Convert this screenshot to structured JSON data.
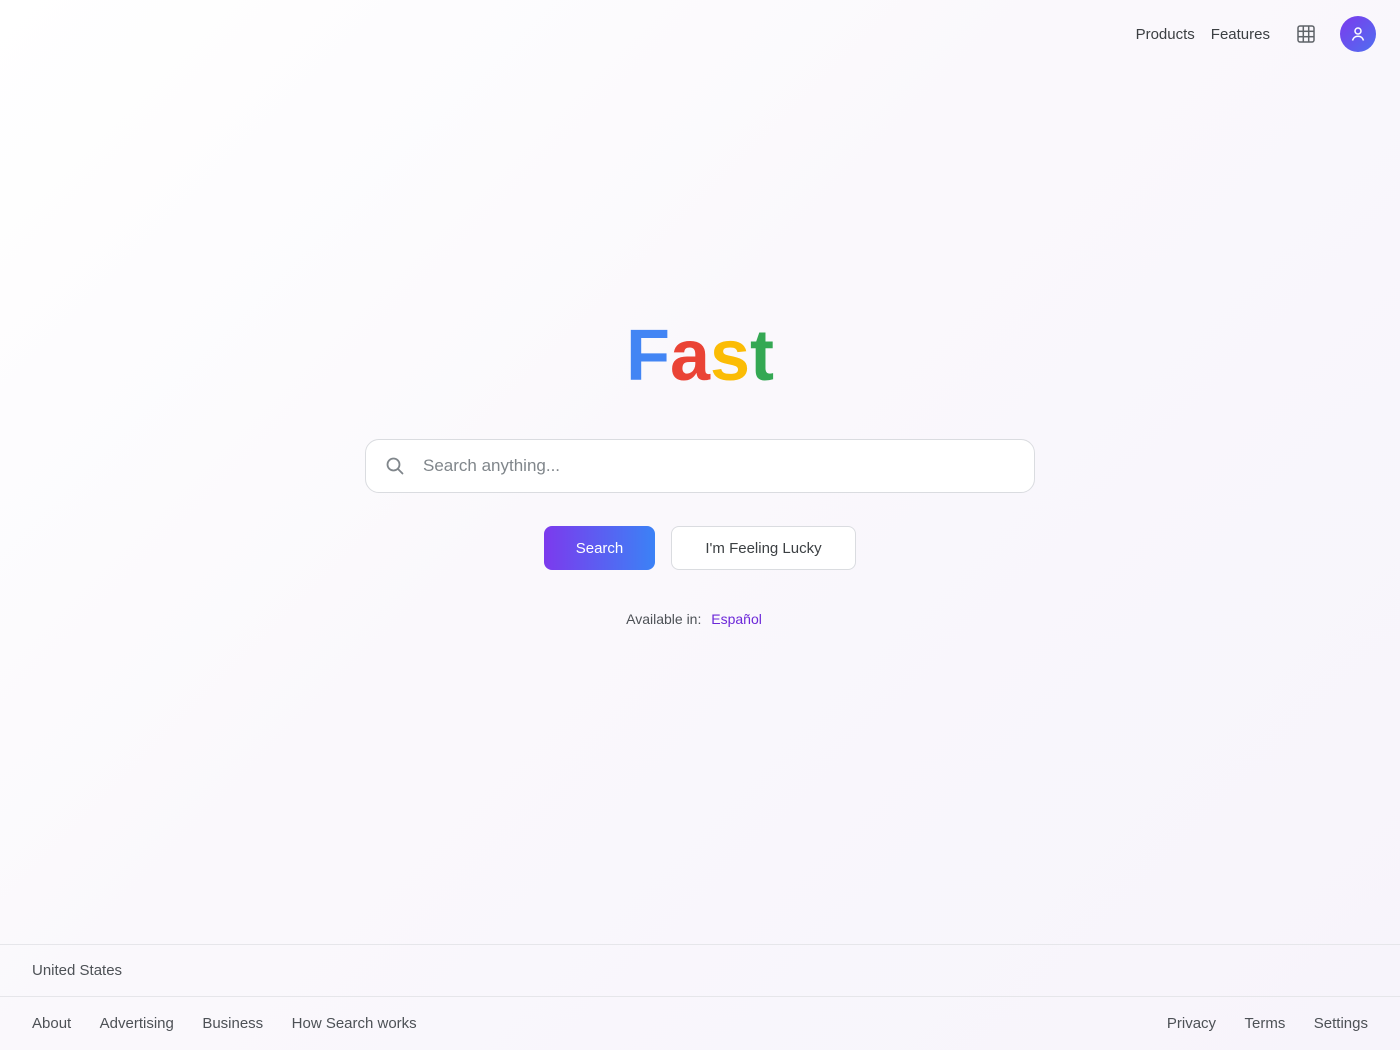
{
  "header": {
    "links": [
      "Products",
      "Features"
    ],
    "apps_icon": "grid-icon",
    "avatar_icon": "user-icon"
  },
  "logo": {
    "letters": [
      "F",
      "a",
      "s",
      "t"
    ],
    "colors": [
      "#4285f4",
      "#ea4335",
      "#fbbc05",
      "#34a853"
    ]
  },
  "search": {
    "placeholder": "Search anything...",
    "value": "",
    "icon": "search-icon"
  },
  "buttons": {
    "search_label": "Search",
    "lucky_label": "I'm Feeling Lucky"
  },
  "languages": {
    "prefix": "Available in:",
    "items": [
      "Español",
      "",
      ""
    ]
  },
  "footer": {
    "country": "United States",
    "left_links": [
      "About",
      "Advertising",
      "Business",
      "How Search works"
    ],
    "right_links": [
      "Privacy",
      "Terms",
      "Settings"
    ]
  },
  "colors": {
    "accent_start": "#7c3aed",
    "accent_end": "#3b82f6",
    "link_purple": "#6d28d9"
  }
}
